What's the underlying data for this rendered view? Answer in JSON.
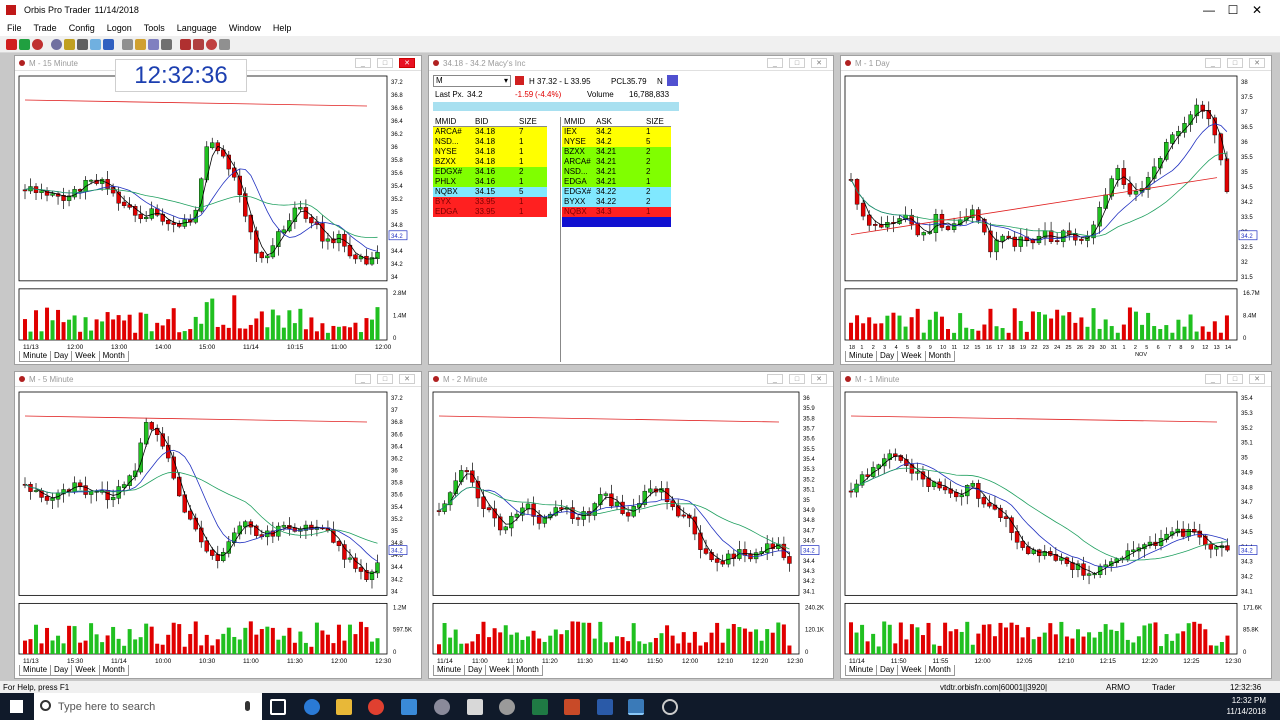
{
  "app": {
    "title": "Orbis Pro Trader",
    "date": "11/14/2018",
    "minimize": "—",
    "maximize": "☐",
    "close": "✕"
  },
  "menu": [
    "File",
    "Trade",
    "Config",
    "Logon",
    "Tools",
    "Language",
    "Window",
    "Help"
  ],
  "clock": "12:32:36",
  "tabs": {
    "minute": "Minute",
    "day": "Day",
    "week": "Week",
    "month": "Month"
  },
  "colors": {
    "up": "#20c020",
    "down": "#e00000",
    "ma_red": "#e02020",
    "ma_green": "#20a060",
    "ma_blue": "#2030c0",
    "ma_black": "#000000",
    "clock": "#1c3fb0"
  },
  "charts": [
    {
      "id": "m15",
      "title": "M - 15 Minute",
      "yticks": [
        "37.2",
        "36.8",
        "36.6",
        "36.4",
        "36.2",
        "36",
        "35.8",
        "35.6",
        "35.4",
        "35.2",
        "35",
        "34.8",
        "34.6",
        "34.4",
        "34.2",
        "34"
      ],
      "last": "34.2",
      "vol_ticks": [
        "2.8M",
        "1.4M",
        "0"
      ],
      "xlabels": [
        "11/13",
        "12:00",
        "13:00",
        "14:00",
        "15:00",
        "11/14",
        "10:15",
        "11:00",
        "12:00"
      ]
    },
    {
      "id": "d1",
      "title": "M - 1 Day",
      "yticks": [
        "38",
        "37.5",
        "37",
        "36.5",
        "36",
        "35.5",
        "35",
        "34.5",
        "34.2",
        "33.5",
        "33",
        "32.5",
        "32",
        "31.5"
      ],
      "last": "34.2",
      "vol_ticks": [
        "16.7M",
        "8.4M",
        "0"
      ],
      "xlabels": [
        "18",
        "1",
        "2",
        "3",
        "4",
        "5",
        "8",
        "9",
        "10",
        "11",
        "12",
        "15",
        "16",
        "17",
        "18",
        "19",
        "22",
        "23",
        "24",
        "25",
        "26",
        "29",
        "30",
        "31",
        "1",
        "2",
        "5",
        "6",
        "7",
        "8",
        "9",
        "12",
        "13",
        "14"
      ],
      "xsub": "NOV"
    },
    {
      "id": "m5",
      "title": "M - 5 Minute",
      "yticks": [
        "37.2",
        "37",
        "36.8",
        "36.6",
        "36.4",
        "36.2",
        "36",
        "35.8",
        "35.6",
        "35.4",
        "35.2",
        "35",
        "34.8",
        "34.6",
        "34.4",
        "34.2",
        "34"
      ],
      "last": "34.2",
      "vol_ticks": [
        "1.2M",
        "597.5K",
        "0"
      ],
      "xlabels": [
        "11/13",
        "15:30",
        "11/14",
        "10:00",
        "10:30",
        "11:00",
        "11:30",
        "12:00",
        "12:30"
      ]
    },
    {
      "id": "m2",
      "title": "M - 2 Minute",
      "yticks": [
        "36",
        "35.9",
        "35.8",
        "35.7",
        "35.6",
        "35.5",
        "35.4",
        "35.3",
        "35.2",
        "35.1",
        "35",
        "34.9",
        "34.8",
        "34.7",
        "34.6",
        "34.5",
        "34.4",
        "34.3",
        "34.2",
        "34.1"
      ],
      "last": "34.2",
      "vol_ticks": [
        "240.2K",
        "120.1K",
        "0"
      ],
      "xlabels": [
        "11/14",
        "11:00",
        "11:10",
        "11:20",
        "11:30",
        "11:40",
        "11:50",
        "12:00",
        "12:10",
        "12:20",
        "12:30"
      ]
    },
    {
      "id": "m1",
      "title": "M - 1 Minute",
      "yticks": [
        "35.4",
        "35.3",
        "35.2",
        "35.1",
        "35",
        "34.9",
        "34.8",
        "34.7",
        "34.6",
        "34.5",
        "34.4",
        "34.3",
        "34.2",
        "34.1"
      ],
      "last": "34.2",
      "vol_ticks": [
        "171.6K",
        "85.8K",
        "0"
      ],
      "xlabels": [
        "11/14",
        "11:50",
        "11:55",
        "12:00",
        "12:05",
        "12:10",
        "12:15",
        "12:20",
        "12:25",
        "12:30"
      ]
    }
  ],
  "level2": {
    "title": "34.18 - 34.2   Macy's Inc",
    "symbol": "M",
    "hilo": "H 37.32 - L 33.95",
    "pcl": "PCL35.79",
    "n": "N",
    "last_label": "Last Px.",
    "last": "34.2",
    "chg": "-1.59",
    "chgpct": "(-4.4%)",
    "vol_label": "Volume",
    "vol": "16,788,833",
    "bid_headers": [
      "MMID",
      "BID",
      "SIZE"
    ],
    "ask_headers": [
      "MMID",
      "ASK",
      "SIZE"
    ],
    "bids": [
      {
        "mmid": "ARCA#",
        "px": "34.18",
        "size": "7",
        "bg": "#ffff00",
        "fg": "#000"
      },
      {
        "mmid": "NSD...",
        "px": "34.18",
        "size": "1",
        "bg": "#ffff00",
        "fg": "#000"
      },
      {
        "mmid": "NYSE",
        "px": "34.18",
        "size": "1",
        "bg": "#ffff00",
        "fg": "#000"
      },
      {
        "mmid": "BZXX",
        "px": "34.18",
        "size": "1",
        "bg": "#ffff00",
        "fg": "#000"
      },
      {
        "mmid": "EDGX#",
        "px": "34.16",
        "size": "2",
        "bg": "#80ff00",
        "fg": "#000"
      },
      {
        "mmid": "PHLX",
        "px": "34.16",
        "size": "1",
        "bg": "#80ff00",
        "fg": "#000"
      },
      {
        "mmid": "NQBX",
        "px": "34.15",
        "size": "5",
        "bg": "#80e8ff",
        "fg": "#000"
      },
      {
        "mmid": "BYX",
        "px": "33.95",
        "size": "1",
        "bg": "#ff2020",
        "fg": "#7a0000"
      },
      {
        "mmid": "EDGA",
        "px": "33.95",
        "size": "1",
        "bg": "#ff2020",
        "fg": "#7a0000"
      }
    ],
    "asks": [
      {
        "mmid": "IEX",
        "px": "34.2",
        "size": "1",
        "bg": "#ffff00",
        "fg": "#000"
      },
      {
        "mmid": "NYSE",
        "px": "34.2",
        "size": "5",
        "bg": "#ffff00",
        "fg": "#000"
      },
      {
        "mmid": "BZXX",
        "px": "34.21",
        "size": "2",
        "bg": "#80ff00",
        "fg": "#000"
      },
      {
        "mmid": "ARCA#",
        "px": "34.21",
        "size": "2",
        "bg": "#80ff00",
        "fg": "#000"
      },
      {
        "mmid": "NSD...",
        "px": "34.21",
        "size": "2",
        "bg": "#80ff00",
        "fg": "#000"
      },
      {
        "mmid": "EDGA",
        "px": "34.21",
        "size": "1",
        "bg": "#80ff00",
        "fg": "#000"
      },
      {
        "mmid": "EDGX#",
        "px": "34.22",
        "size": "2",
        "bg": "#80e8ff",
        "fg": "#000"
      },
      {
        "mmid": "BYXX",
        "px": "34.22",
        "size": "2",
        "bg": "#80e8ff",
        "fg": "#000"
      },
      {
        "mmid": "NQBX",
        "px": "34.3",
        "size": "1",
        "bg": "#ff2020",
        "fg": "#7a0000"
      },
      {
        "mmid": "",
        "px": "",
        "size": "",
        "bg": "#1010d0",
        "fg": "#000"
      }
    ]
  },
  "status": {
    "help": "For Help, press F1",
    "server": "vtdtr.orbisfn.com|60001||3920|",
    "acct": "ARMO",
    "role": "Trader",
    "time": "12:32:36"
  },
  "taskbar": {
    "search_placeholder": "Type here to search",
    "clock": "12:32 PM",
    "date": "11/14/2018"
  }
}
